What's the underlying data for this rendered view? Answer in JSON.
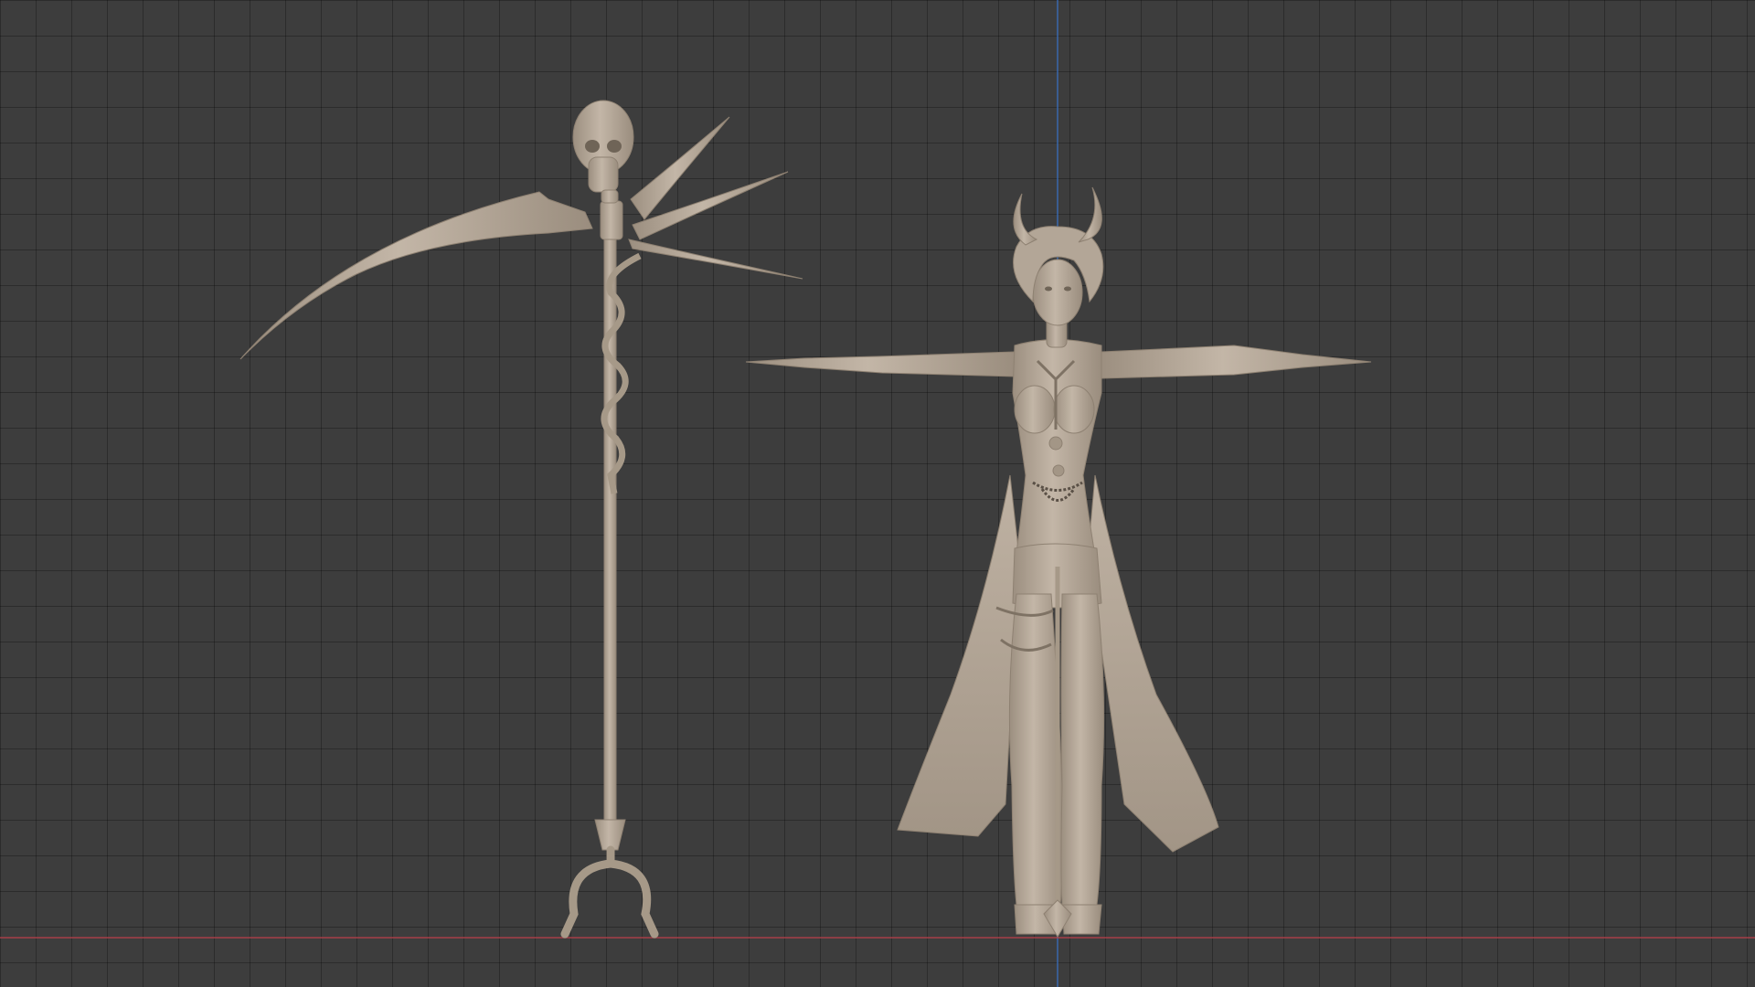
{
  "viewport": {
    "background_color": "#3d3d3d",
    "grid_line_color": "#2b2b2b",
    "x_axis_color": "#b2404a",
    "z_axis_color": "#3a73c8",
    "model_color": "#b7aa9b"
  },
  "objects": [
    {
      "name": "scythe",
      "icon": "skull-scythe"
    },
    {
      "name": "demon-character",
      "icon": "t-pose-figure"
    }
  ]
}
